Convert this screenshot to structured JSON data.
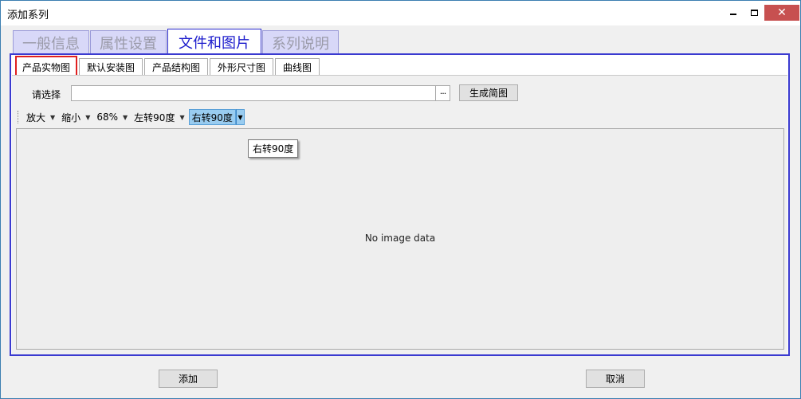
{
  "window": {
    "title": "添加系列",
    "close_symbol": "✕"
  },
  "main_tabs": [
    {
      "label": "一般信息",
      "active": false
    },
    {
      "label": "属性设置",
      "active": false
    },
    {
      "label": "文件和图片",
      "active": true
    },
    {
      "label": "系列说明",
      "active": false
    }
  ],
  "sub_tabs": [
    {
      "label": "产品实物图",
      "active": true
    },
    {
      "label": "默认安装图",
      "active": false
    },
    {
      "label": "产品结构图",
      "active": false
    },
    {
      "label": "外形尺寸图",
      "active": false
    },
    {
      "label": "曲线图",
      "active": false
    }
  ],
  "file_select": {
    "label": "请选择",
    "value": "",
    "browse_label": "···",
    "generate_label": "生成简图"
  },
  "toolbar": {
    "zoom_in": "放大",
    "zoom_out": "缩小",
    "zoom_level": "68%",
    "rotate_left": "左转90度",
    "rotate_right": "右转90度"
  },
  "image_area": {
    "placeholder": "No image data"
  },
  "tooltip": {
    "text": "右转90度"
  },
  "footer": {
    "add_label": "添加",
    "cancel_label": "取消"
  },
  "colors": {
    "active_tab_text": "#1b1bcc",
    "inactive_tab_bg": "#d8d8f8",
    "panel_border": "#3a3ad0",
    "selected_subtab_border": "#e02020",
    "highlight": "#99ccf0"
  }
}
